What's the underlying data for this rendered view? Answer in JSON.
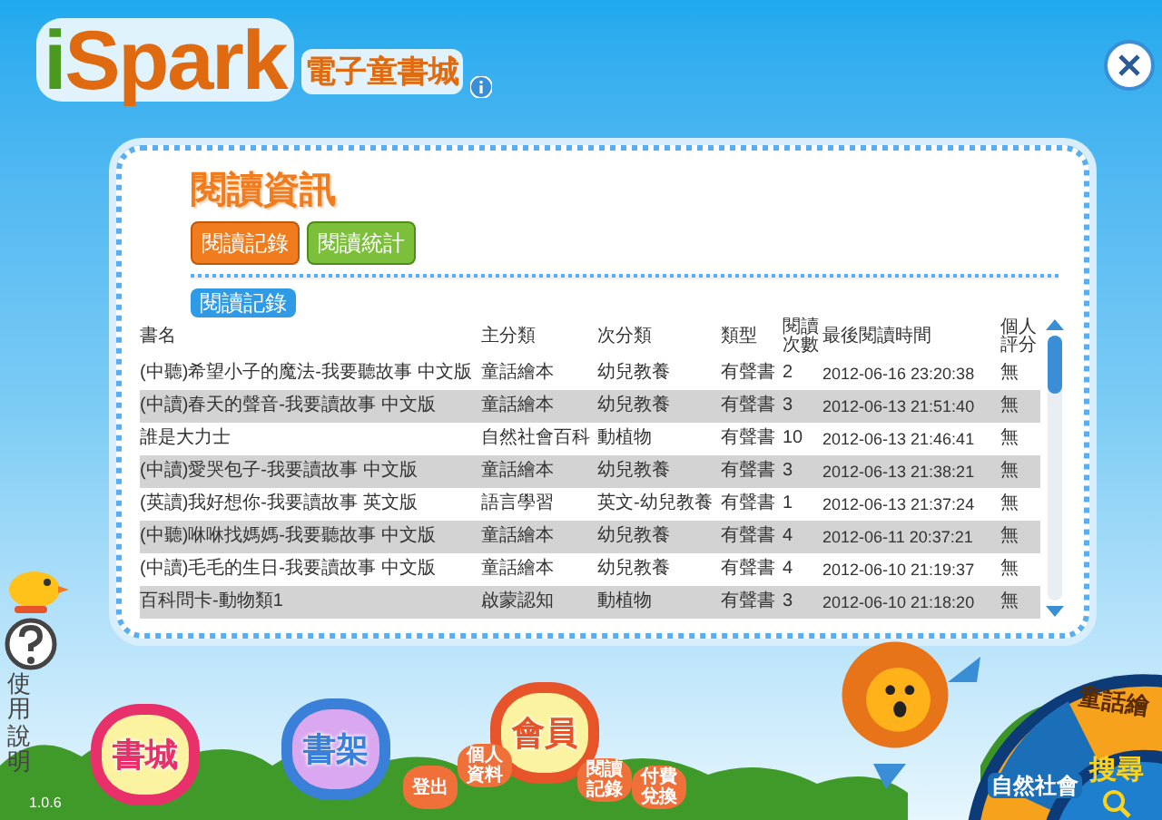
{
  "logo": {
    "title": "iSpark",
    "subtitle": "電子童書城"
  },
  "page_title": "閱讀資訊",
  "tabs": [
    {
      "label": "閱讀記錄",
      "selected": true
    },
    {
      "label": "閱讀統計",
      "selected": false
    }
  ],
  "section_label": "閱讀記錄",
  "table": {
    "columns": [
      "書名",
      "主分類",
      "次分類",
      "類型",
      "閱讀次數",
      "最後閱讀時間",
      "個人評分"
    ],
    "rows": [
      [
        "(中聽)希望小子的魔法-我要聽故事 中文版",
        "童話繪本",
        "幼兒教養",
        "有聲書",
        "2",
        "2012-06-16 23:20:38",
        "無"
      ],
      [
        "(中讀)春天的聲音-我要讀故事 中文版",
        "童話繪本",
        "幼兒教養",
        "有聲書",
        "3",
        "2012-06-13 21:51:40",
        "無"
      ],
      [
        "誰是大力士",
        "自然社會百科",
        "動植物",
        "有聲書",
        "10",
        "2012-06-13 21:46:41",
        "無"
      ],
      [
        "(中讀)愛哭包子-我要讀故事 中文版",
        "童話繪本",
        "幼兒教養",
        "有聲書",
        "3",
        "2012-06-13 21:38:21",
        "無"
      ],
      [
        "(英讀)我好想你-我要讀故事 英文版",
        "語言學習",
        "英文-幼兒教養",
        "有聲書",
        "1",
        "2012-06-13 21:37:24",
        "無"
      ],
      [
        "(中聽)咻咻找媽媽-我要聽故事 中文版",
        "童話繪本",
        "幼兒教養",
        "有聲書",
        "4",
        "2012-06-11 20:37:21",
        "無"
      ],
      [
        "(中讀)毛毛的生日-我要讀故事 中文版",
        "童話繪本",
        "幼兒教養",
        "有聲書",
        "4",
        "2012-06-10 21:19:37",
        "無"
      ],
      [
        "百科問卡-動物類1",
        "啟蒙認知",
        "動植物",
        "有聲書",
        "3",
        "2012-06-10 21:18:20",
        "無"
      ]
    ]
  },
  "help": {
    "label": "使用說明"
  },
  "version": "1.0.6",
  "nav": [
    {
      "label": "書城",
      "color": "#e8306a"
    },
    {
      "label": "書架",
      "color": "#3a7fd8"
    },
    {
      "label": "會員",
      "color": "#e8542a"
    }
  ],
  "member_menu": [
    "登出",
    "個人資料",
    "閱讀記錄",
    "付費兌換"
  ],
  "wheel": {
    "categories": [
      "童話繪",
      "自然社會"
    ],
    "search": "搜尋"
  }
}
